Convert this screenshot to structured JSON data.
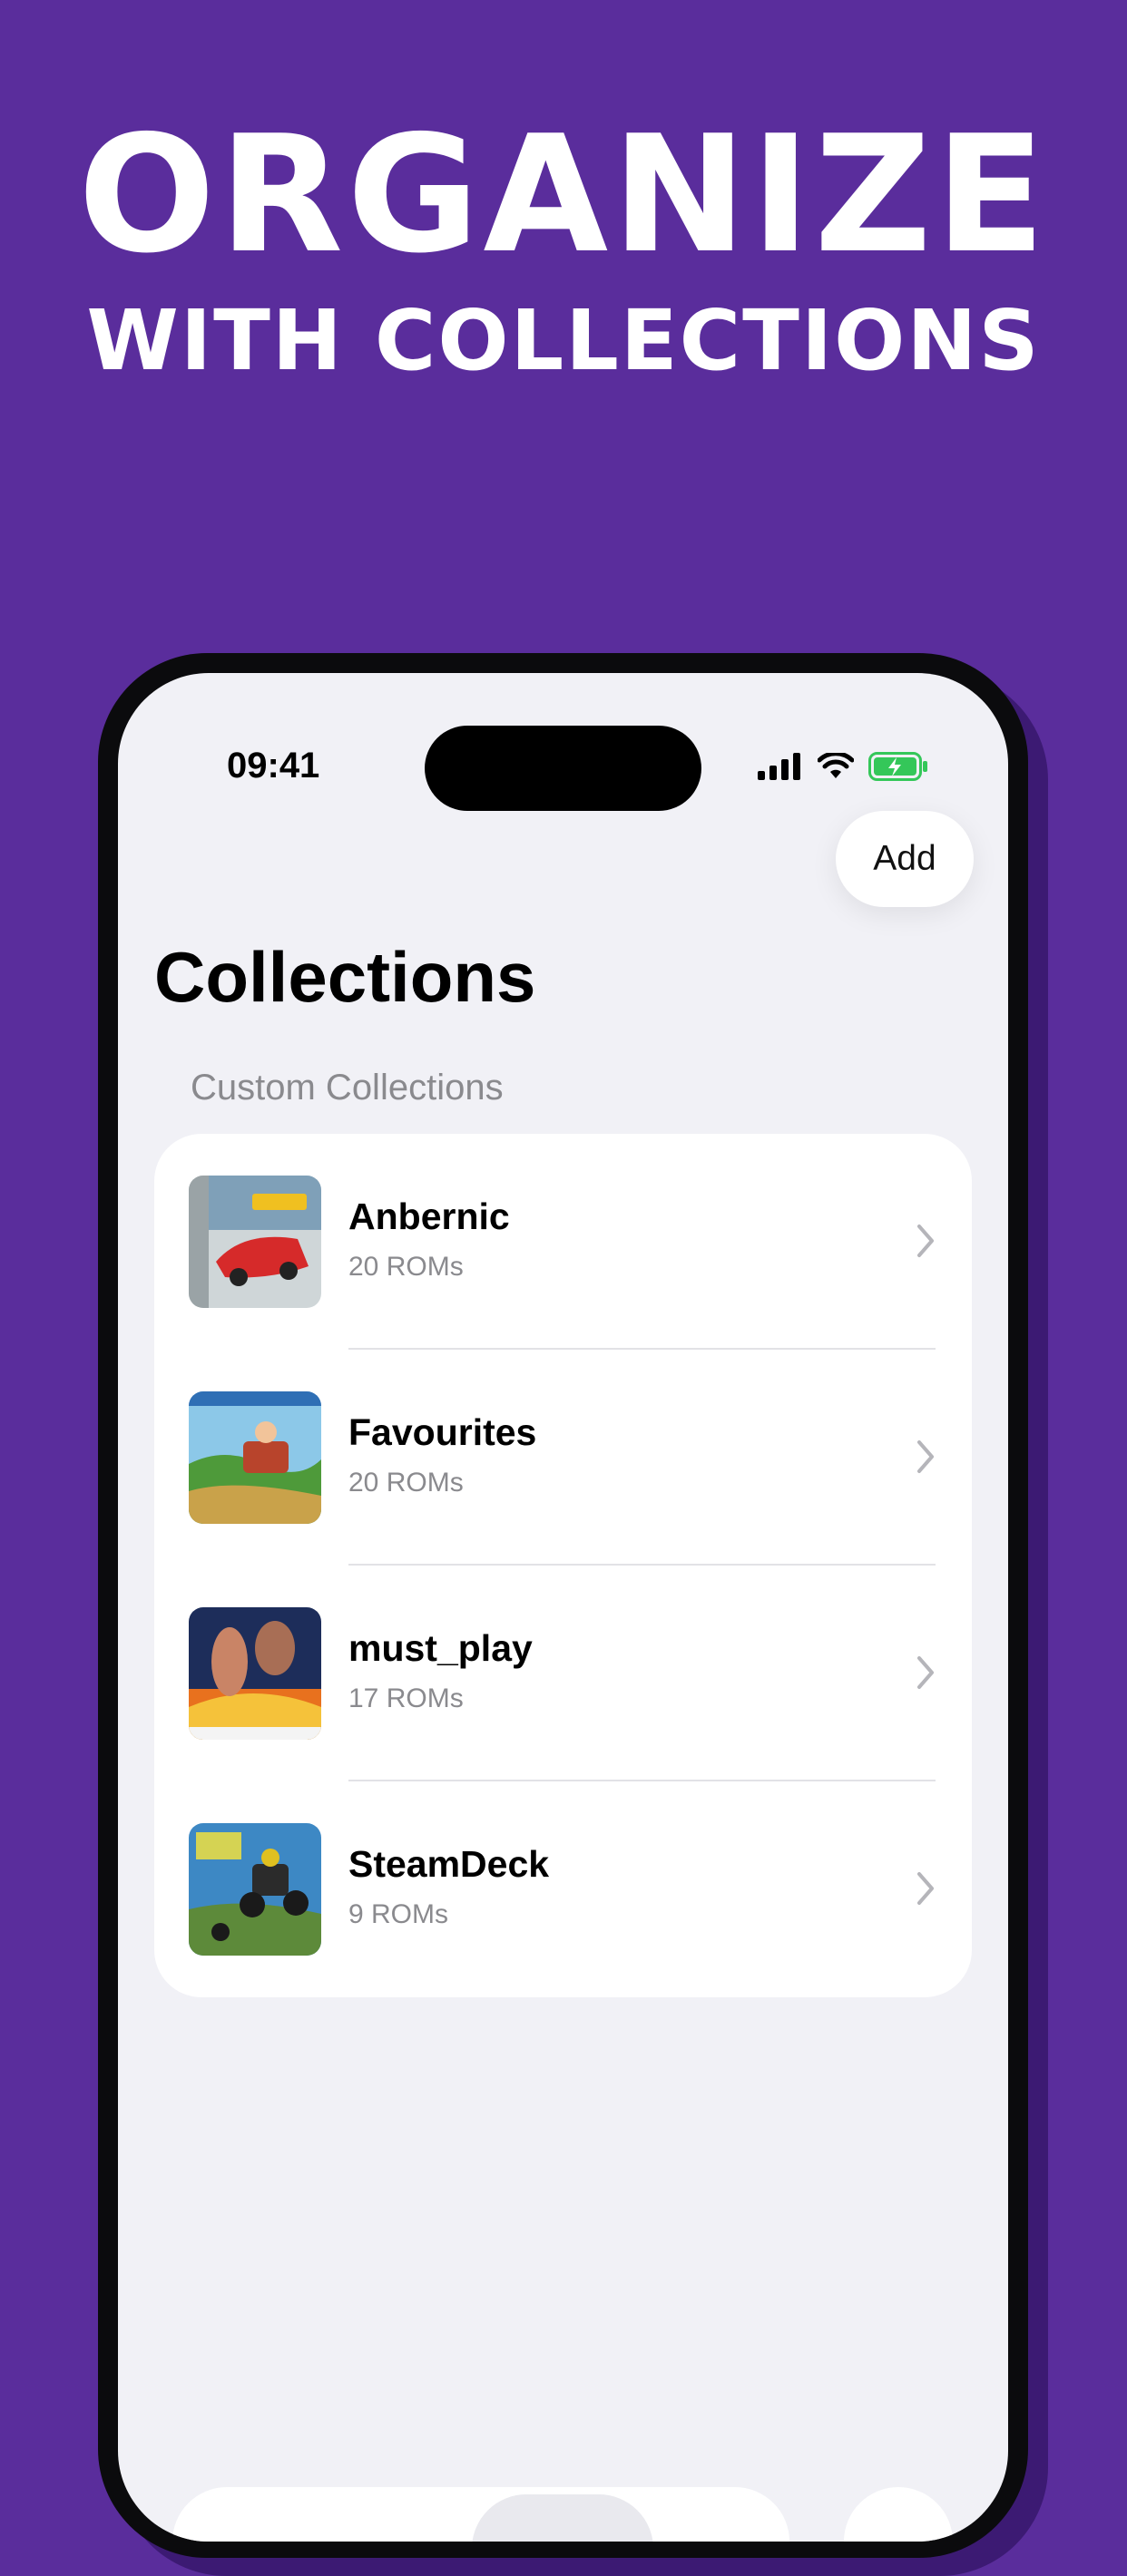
{
  "hero": {
    "line1": "ORGANIZE",
    "line2": "WITH COLLECTIONS"
  },
  "status_bar": {
    "time": "09:41",
    "icons": [
      "cellular-signal-icon",
      "wifi-icon",
      "battery-charging-icon"
    ]
  },
  "toolbar": {
    "add_label": "Add"
  },
  "page": {
    "title": "Collections",
    "section_header": "Custom Collections"
  },
  "collections": [
    {
      "name": "Anbernic",
      "count": "20 ROMs",
      "thumbnail": "racing-game-cover"
    },
    {
      "name": "Favourites",
      "count": "20 ROMs",
      "thumbnail": "adventure-game-cover"
    },
    {
      "name": "must_play",
      "count": "17 ROMs",
      "thumbnail": "action-game-cover"
    },
    {
      "name": "SteamDeck",
      "count": "9 ROMs",
      "thumbnail": "atv-racing-game-cover"
    }
  ],
  "colors": {
    "background": "#5a2d9c",
    "screen": "#f1f1f6",
    "battery": "#34c759"
  }
}
